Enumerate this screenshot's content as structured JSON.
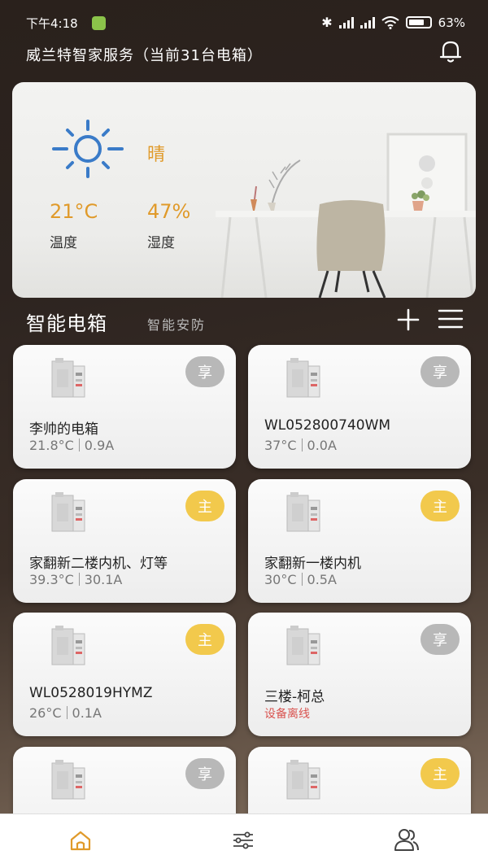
{
  "status_bar": {
    "time": "下午4:18",
    "battery": "63%"
  },
  "header": {
    "title": "威兰特智家服务（当前31台电箱）"
  },
  "weather": {
    "condition": "晴",
    "temperature": "21°C",
    "temperature_label": "温度",
    "humidity": "47%",
    "humidity_label": "湿度"
  },
  "section": {
    "title": "智能电箱",
    "tab": "智能安防"
  },
  "devices": [
    {
      "name": "李帅的电箱",
      "temp": "21.8°C",
      "current": "0.9A",
      "badge": "享",
      "badge_type": "share"
    },
    {
      "name": "WL052800740WM",
      "temp": "37°C",
      "current": "0.0A",
      "badge": "享",
      "badge_type": "share"
    },
    {
      "name": "家翻新二楼内机、灯等",
      "temp": "39.3°C",
      "current": "30.1A",
      "badge": "主",
      "badge_type": "main"
    },
    {
      "name": "家翻新一楼内机",
      "temp": "30°C",
      "current": "0.5A",
      "badge": "主",
      "badge_type": "main"
    },
    {
      "name": "WL0528019HYMZ",
      "temp": "26°C",
      "current": "0.1A",
      "badge": "主",
      "badge_type": "main"
    },
    {
      "name": "三楼-柯总",
      "status": "设备离线",
      "badge": "享",
      "badge_type": "share"
    },
    {
      "badge": "享",
      "badge_type": "share"
    },
    {
      "badge": "主",
      "badge_type": "main"
    }
  ],
  "colors": {
    "accent": "#e09a2a",
    "badge_main": "#f2c94c",
    "badge_share": "#b8b8b8",
    "offline": "#d9534f"
  }
}
